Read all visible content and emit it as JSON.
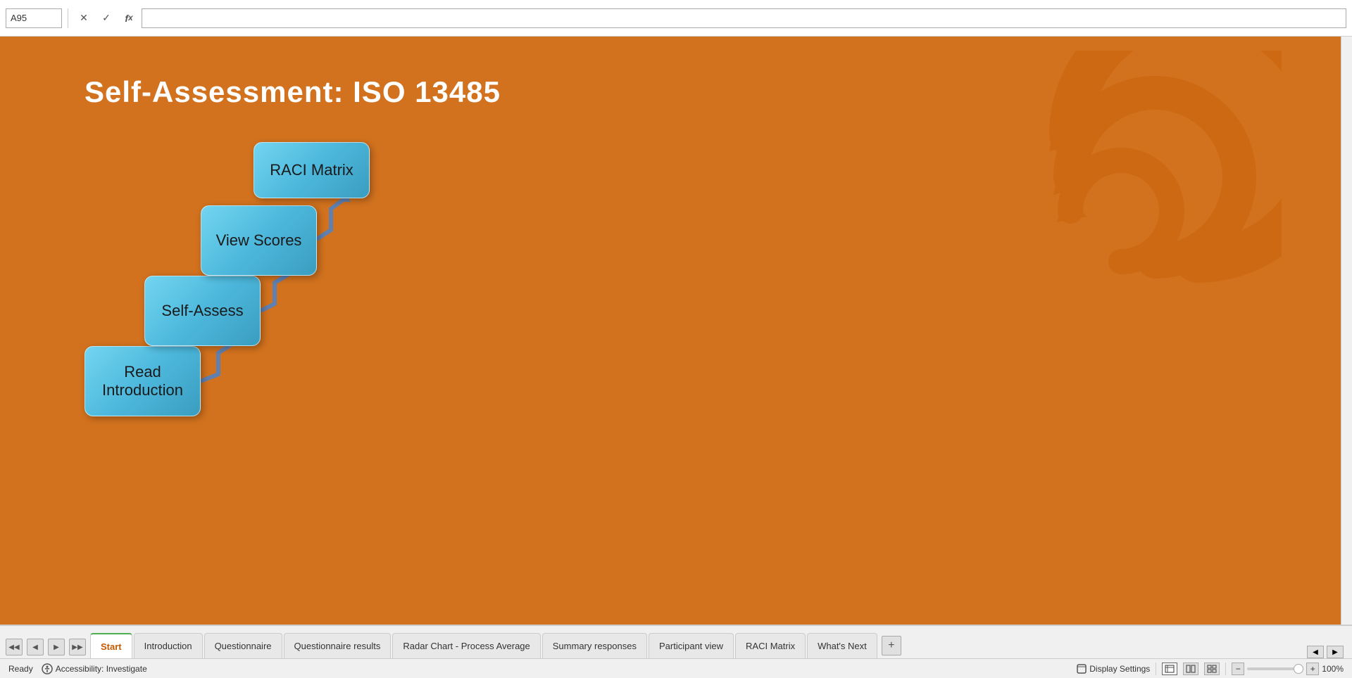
{
  "excel": {
    "cell_name": "A95",
    "formula_bar_value": "",
    "icons": {
      "cancel": "✕",
      "confirm": "✓",
      "function": "f",
      "subscript": "x"
    }
  },
  "page": {
    "title": "Self-Assessment: ISO 13485",
    "background_color": "#D2721E"
  },
  "nav_boxes": [
    {
      "id": "read-intro",
      "label": "Read\nIntroduction"
    },
    {
      "id": "self-assess",
      "label": "Self-Assess"
    },
    {
      "id": "view-scores",
      "label": "View Scores"
    },
    {
      "id": "raci-matrix",
      "label": "RACI Matrix"
    }
  ],
  "tabs": [
    {
      "id": "start",
      "label": "Start",
      "active": true
    },
    {
      "id": "introduction",
      "label": "Introduction",
      "active": false
    },
    {
      "id": "questionnaire",
      "label": "Questionnaire",
      "active": false
    },
    {
      "id": "questionnaire-results",
      "label": "Questionnaire results",
      "active": false
    },
    {
      "id": "radar-chart",
      "label": "Radar Chart - Process Average",
      "active": false
    },
    {
      "id": "summary-responses",
      "label": "Summary responses",
      "active": false
    },
    {
      "id": "participant-view",
      "label": "Participant view",
      "active": false
    },
    {
      "id": "raci-matrix-tab",
      "label": "RACI Matrix",
      "active": false
    },
    {
      "id": "whats-next",
      "label": "What's Next",
      "active": false
    }
  ],
  "status_bar": {
    "ready": "Ready",
    "accessibility": "Accessibility: Investigate",
    "display_settings": "Display Settings",
    "zoom": "100%"
  }
}
